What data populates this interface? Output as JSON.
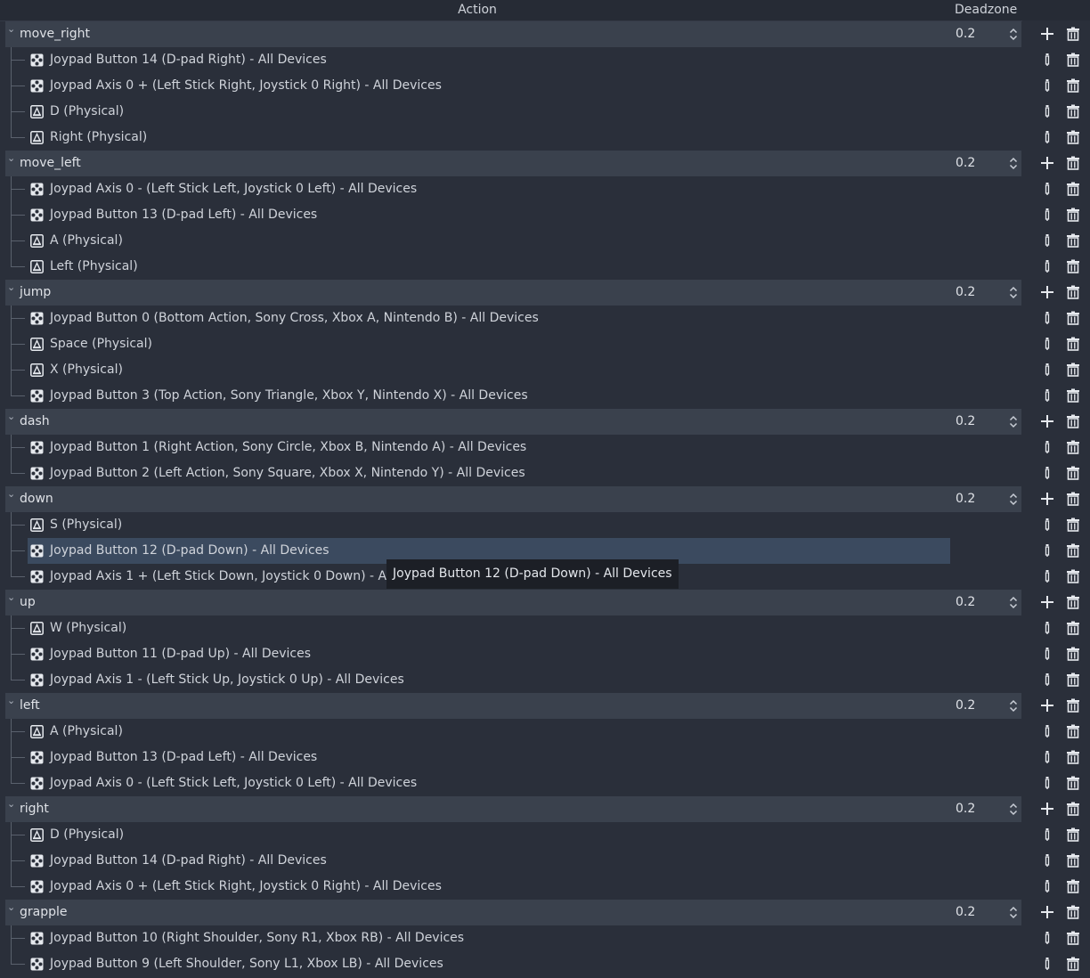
{
  "header": {
    "action_label": "Action",
    "deadzone_label": "Deadzone"
  },
  "tooltip": "Joypad Button 12 (D-pad Down) - All Devices",
  "icons": {
    "group_add": "plus-icon",
    "group_remove": "trash-icon",
    "event_edit": "edit-icon",
    "event_remove": "trash-icon",
    "expand": "chevron-down-icon",
    "spin": "spinbox-arrows-icon",
    "joypad": "joypad-icon",
    "keyboard": "keyboard-key-icon"
  },
  "colors": {
    "selection": "#3b4a5f",
    "group_row": "#3a414d",
    "background": "#2a2f3a"
  },
  "actions": [
    {
      "name": "move_right",
      "deadzone": "0.2",
      "events": [
        {
          "icon": "joypad",
          "label": "Joypad Button 14 (D-pad Right) - All Devices"
        },
        {
          "icon": "joypad",
          "label": "Joypad Axis 0 + (Left Stick Right, Joystick 0 Right) - All Devices"
        },
        {
          "icon": "keyboard",
          "label": "D (Physical)"
        },
        {
          "icon": "keyboard",
          "label": "Right (Physical)"
        }
      ]
    },
    {
      "name": "move_left",
      "deadzone": "0.2",
      "events": [
        {
          "icon": "joypad",
          "label": "Joypad Axis 0 - (Left Stick Left, Joystick 0 Left) - All Devices"
        },
        {
          "icon": "joypad",
          "label": "Joypad Button 13 (D-pad Left) - All Devices"
        },
        {
          "icon": "keyboard",
          "label": "A (Physical)"
        },
        {
          "icon": "keyboard",
          "label": "Left (Physical)"
        }
      ]
    },
    {
      "name": "jump",
      "deadzone": "0.2",
      "events": [
        {
          "icon": "joypad",
          "label": "Joypad Button 0 (Bottom Action, Sony Cross, Xbox A, Nintendo B) - All Devices"
        },
        {
          "icon": "keyboard",
          "label": "Space (Physical)"
        },
        {
          "icon": "keyboard",
          "label": "X (Physical)"
        },
        {
          "icon": "joypad",
          "label": "Joypad Button 3 (Top Action, Sony Triangle, Xbox Y, Nintendo X) - All Devices"
        }
      ]
    },
    {
      "name": "dash",
      "deadzone": "0.2",
      "events": [
        {
          "icon": "joypad",
          "label": "Joypad Button 1 (Right Action, Sony Circle, Xbox B, Nintendo A) - All Devices"
        },
        {
          "icon": "joypad",
          "label": "Joypad Button 2 (Left Action, Sony Square, Xbox X, Nintendo Y) - All Devices"
        }
      ]
    },
    {
      "name": "down",
      "deadzone": "0.2",
      "events": [
        {
          "icon": "keyboard",
          "label": "S (Physical)"
        },
        {
          "icon": "joypad",
          "label": "Joypad Button 12 (D-pad Down) - All Devices",
          "selected": true
        },
        {
          "icon": "joypad",
          "label": "Joypad Axis 1 + (Left Stick Down, Joystick 0 Down) - All Devices"
        }
      ]
    },
    {
      "name": "up",
      "deadzone": "0.2",
      "events": [
        {
          "icon": "keyboard",
          "label": "W (Physical)"
        },
        {
          "icon": "joypad",
          "label": "Joypad Button 11 (D-pad Up) - All Devices"
        },
        {
          "icon": "joypad",
          "label": "Joypad Axis 1 - (Left Stick Up, Joystick 0 Up) - All Devices"
        }
      ]
    },
    {
      "name": "left",
      "deadzone": "0.2",
      "events": [
        {
          "icon": "keyboard",
          "label": "A (Physical)"
        },
        {
          "icon": "joypad",
          "label": "Joypad Button 13 (D-pad Left) - All Devices"
        },
        {
          "icon": "joypad",
          "label": "Joypad Axis 0 - (Left Stick Left, Joystick 0 Left) - All Devices"
        }
      ]
    },
    {
      "name": "right",
      "deadzone": "0.2",
      "events": [
        {
          "icon": "keyboard",
          "label": "D (Physical)"
        },
        {
          "icon": "joypad",
          "label": "Joypad Button 14 (D-pad Right) - All Devices"
        },
        {
          "icon": "joypad",
          "label": "Joypad Axis 0 + (Left Stick Right, Joystick 0 Right) - All Devices"
        }
      ]
    },
    {
      "name": "grapple",
      "deadzone": "0.2",
      "events": [
        {
          "icon": "joypad",
          "label": "Joypad Button 10 (Right Shoulder, Sony R1, Xbox RB) - All Devices"
        },
        {
          "icon": "joypad",
          "label": "Joypad Button 9 (Left Shoulder, Sony L1, Xbox LB) - All Devices"
        }
      ]
    }
  ]
}
